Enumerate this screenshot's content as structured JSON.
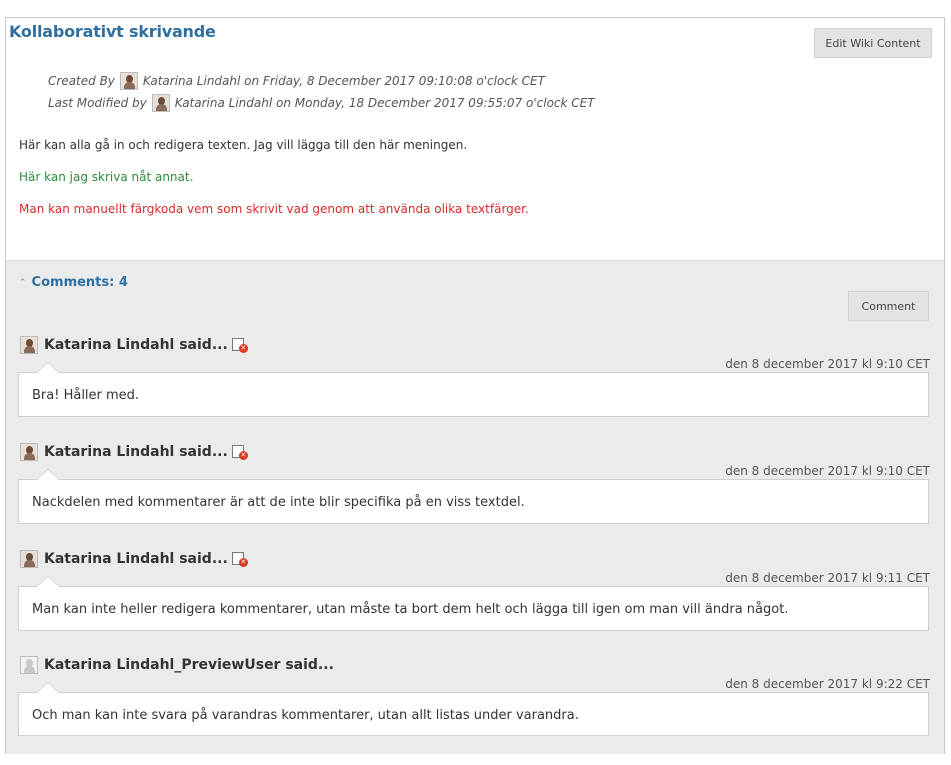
{
  "page": {
    "title": "Kollaborativt skrivande",
    "edit_button": "Edit Wiki Content"
  },
  "meta": {
    "created_label": "Created By",
    "created_text": "Katarina Lindahl on Friday, 8 December 2017 09:10:08 o'clock CET",
    "modified_label": "Last Modified by",
    "modified_text": "Katarina Lindahl on Monday, 18 December 2017 09:55:07 o'clock CET"
  },
  "content": {
    "paragraphs": [
      {
        "text": "Här kan alla gå in och redigera texten. Jag vill lägga till den här meningen.",
        "color": "#333333"
      },
      {
        "text": "Här kan jag skriva nåt annat.",
        "color": "#2e8b3e"
      },
      {
        "text": "Man kan manuellt färgkoda vem som skrivit vad genom att använda olika textfärger.",
        "color": "#d62b2b"
      }
    ]
  },
  "comments": {
    "header": "Comments: 4",
    "comment_button": "Comment",
    "items": [
      {
        "author": "Katarina Lindahl said...",
        "date": "den 8 december 2017 kl 9:10 CET",
        "text": "Bra! Håller med.",
        "avatar": "photo-avatar",
        "deletable": true
      },
      {
        "author": "Katarina Lindahl said...",
        "date": "den 8 december 2017 kl 9:10 CET",
        "text": "Nackdelen med kommentarer är att de inte blir specifika på en viss textdel.",
        "avatar": "photo-avatar",
        "deletable": true
      },
      {
        "author": "Katarina Lindahl said...",
        "date": "den 8 december 2017 kl 9:11 CET",
        "text": "Man kan inte heller redigera kommentarer, utan måste ta bort dem helt och lägga till igen om man vill ändra något.",
        "avatar": "photo-avatar",
        "deletable": true
      },
      {
        "author": "Katarina Lindahl_PreviewUser said...",
        "date": "den 8 december 2017 kl 9:22 CET",
        "text": "Och man kan inte svara på varandras kommentarer, utan allt listas under varandra.",
        "avatar": "default-avatar",
        "deletable": false
      }
    ]
  },
  "colors": {
    "link": "#2f6f9f",
    "green_text": "#2e8b3e",
    "red_text": "#d62b2b"
  }
}
